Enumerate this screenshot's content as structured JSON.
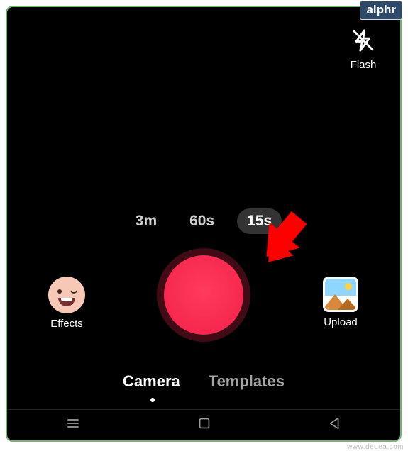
{
  "badge": {
    "label": "alphr"
  },
  "watermark": "www.deuea.com",
  "flash": {
    "label": "Flash",
    "icon": "flash-off-icon"
  },
  "durations": {
    "options": [
      "3m",
      "60s",
      "15s"
    ],
    "selected_index": 2
  },
  "effects": {
    "label": "Effects",
    "icon": "wink-face-icon"
  },
  "upload": {
    "label": "Upload",
    "icon": "gallery-icon"
  },
  "tabs": {
    "items": [
      "Camera",
      "Templates"
    ],
    "active_index": 0
  },
  "nav": {
    "menu_icon": "menu-icon",
    "home_icon": "square-icon",
    "back_icon": "triangle-back-icon"
  },
  "annotation": {
    "arrow_points_to": "upload-button",
    "color": "#ff0000"
  }
}
